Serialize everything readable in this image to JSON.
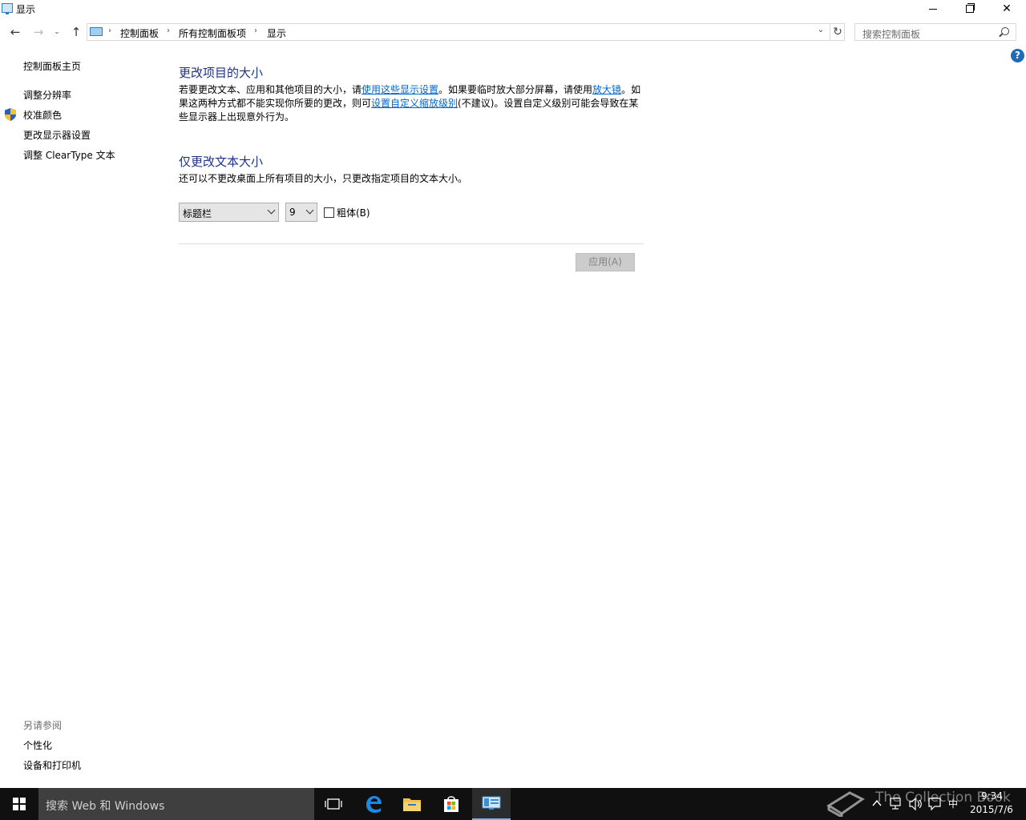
{
  "window": {
    "title": "显示",
    "icon": "display-control-panel-icon",
    "minimize_icon": "minimize-icon",
    "maximize_icon": "restore-icon",
    "close_glyph": "✕"
  },
  "navigation": {
    "back_glyph": "←",
    "forward_glyph": "→",
    "recent_glyph": "⌄",
    "up_glyph": "↑",
    "breadcrumbs": [
      "控制面板",
      "所有控制面板项",
      "显示"
    ],
    "separator": "›",
    "dropdown_glyph": "⌄",
    "refresh_glyph": "↻"
  },
  "search": {
    "placeholder": "搜索控制面板"
  },
  "help": {
    "glyph": "?"
  },
  "sidebar": {
    "home": "控制面板主页",
    "items": [
      "调整分辨率",
      "校准颜色",
      "更改显示器设置",
      "调整 ClearType 文本"
    ],
    "see_also_title": "另请参阅",
    "see_also": [
      "个性化",
      "设备和打印机"
    ]
  },
  "main": {
    "section1": {
      "title": "更改项目的大小",
      "text_a": "若要更改文本、应用和其他项目的大小，请",
      "link_a": "使用这些显示设置",
      "text_b": "。如果要临时放大部分屏幕，请使用",
      "link_b": "放大镜",
      "text_c": "。如果这两种方式都不能实现你所要的更改，则可",
      "link_c": "设置自定义缩放级别",
      "text_d": "(不建议)。设置自定义级别可能会导致在某些显示器上出现意外行为。"
    },
    "section2": {
      "title": "仅更改文本大小",
      "desc": "还可以不更改桌面上所有项目的大小，只更改指定项目的文本大小。",
      "item_select": "标题栏",
      "size_select": "9",
      "bold_label": "粗体(B)",
      "bold_checked": false
    },
    "apply_button": "应用(A)"
  },
  "taskbar": {
    "search_text": "搜索 Web 和 Windows",
    "apps": [
      "task-view-icon",
      "edge-icon",
      "file-explorer-icon",
      "store-icon",
      "control-panel-icon"
    ],
    "tray": {
      "ime": "中",
      "time": "9:34",
      "date": "2015/7/6"
    },
    "watermark": "The Collection Book"
  },
  "colors": {
    "heading": "#1e3287",
    "link": "#0066cc",
    "taskbar": "#101010",
    "taskbar_search": "#3f3f3f"
  }
}
